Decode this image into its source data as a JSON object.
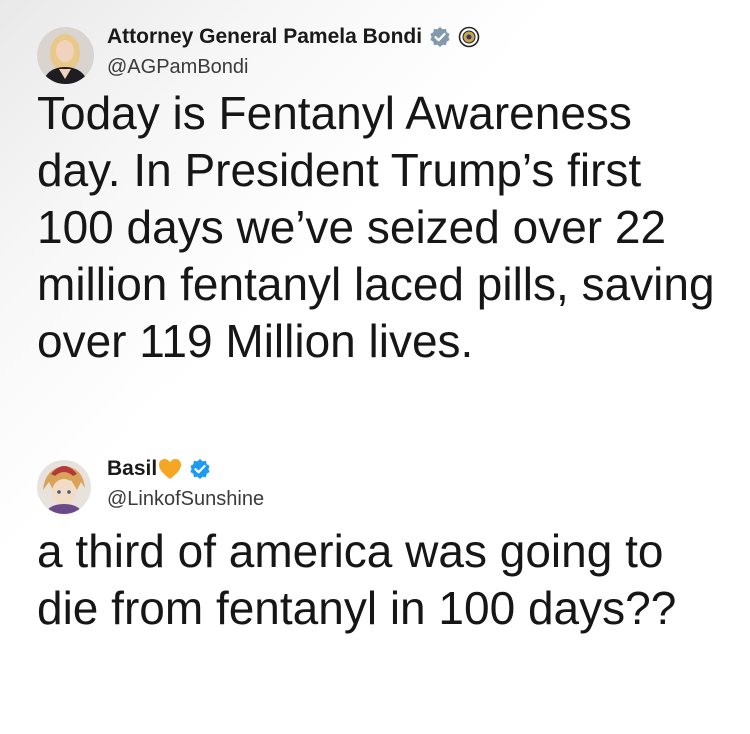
{
  "tweets": [
    {
      "author": {
        "display_name": "Attorney General Pamela Bondi",
        "handle": "@AGPamBondi",
        "badges": [
          "verified-gray-icon",
          "government-seal-icon"
        ],
        "avatar": "avatar-blonde-woman"
      },
      "text": "Today is Fentanyl Awareness day. In President Trump’s first 100 days we’ve seized over 22 million fentanyl laced pills, saving over 119 Million lives."
    },
    {
      "author": {
        "display_name": "Basil",
        "handle": "@LinkofSunshine",
        "badges": [
          "orange-heart-icon",
          "verified-blue-icon"
        ],
        "avatar": "avatar-anime-character"
      },
      "text": "a third of america was going to die from fentanyl in 100 days??"
    }
  ],
  "colors": {
    "verified_gray": "#829aab",
    "verified_blue": "#1d9bf0",
    "heart": "#f5a623",
    "text": "#161616",
    "handle": "#3a3a3a"
  }
}
